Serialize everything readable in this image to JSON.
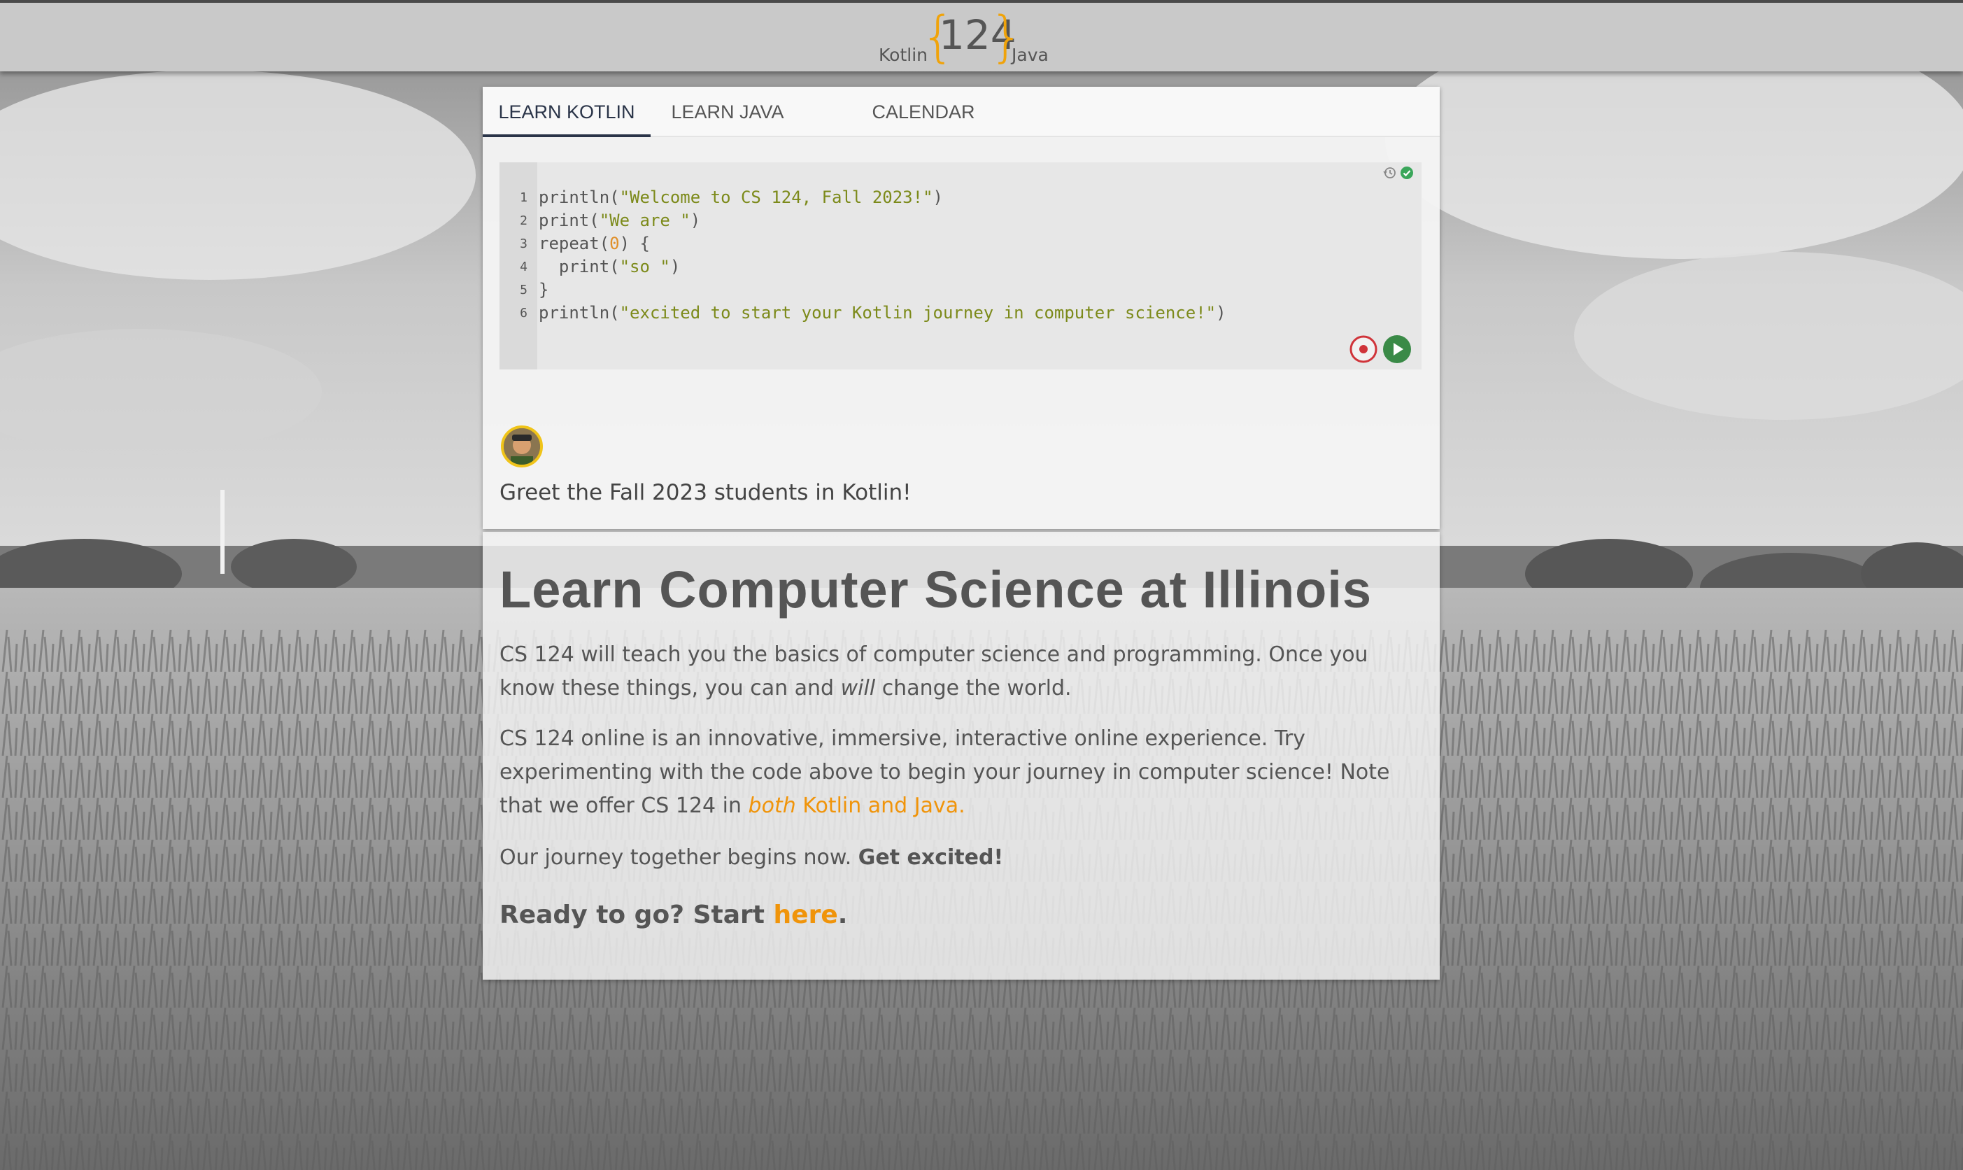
{
  "header": {
    "logo_left": "Kotlin",
    "logo_number": "124",
    "logo_right": "Java",
    "logo_brace_open": "{",
    "logo_brace_close": "}",
    "accent_color": "#f0a30a"
  },
  "tabs": [
    {
      "label": "LEARN KOTLIN",
      "active": true
    },
    {
      "label": "LEARN JAVA",
      "active": false
    },
    {
      "label": "CALENDAR",
      "active": false
    }
  ],
  "editor": {
    "line_numbers": [
      "1",
      "2",
      "3",
      "4",
      "5",
      "6"
    ],
    "lines": [
      {
        "pre": "println(",
        "str": "\"Welcome to CS 124, Fall 2023!\"",
        "post": ")"
      },
      {
        "pre": "print(",
        "str": "\"We are \"",
        "post": ")"
      },
      {
        "pre": "repeat(",
        "num": "0",
        "post": ") {"
      },
      {
        "pre": "  print(",
        "str": "\"so \"",
        "post": ")"
      },
      {
        "pre": "}"
      },
      {
        "pre": "println(",
        "str": "\"excited to start your Kotlin journey in computer science!\"",
        "post": ")"
      }
    ],
    "icons": [
      "history-icon",
      "check-circle-icon",
      "stop-record-icon",
      "play-icon"
    ],
    "string_color": "#7c8a1a",
    "number_color": "#e0902a"
  },
  "caption": "Greet the Fall 2023 students in Kotlin!",
  "content": {
    "headline": "Learn Computer Science at Illinois",
    "p1_a": "CS 124 will teach you the basics of computer science and programming. Once you know these things, you can and ",
    "p1_em": "will",
    "p1_b": " change the world.",
    "p2_a": "CS 124 online is an innovative, immersive, interactive online experience. Try experimenting with the code above to begin your journey in computer science! Note that we offer CS 124 in ",
    "p2_link_em": "both",
    "p2_link": " Kotlin and Java.",
    "p3_a": "Our journey together begins now. ",
    "p3_b": "Get excited!",
    "p4_a": "Ready to go? Start ",
    "p4_link": "here",
    "p4_b": ".",
    "link_color": "#f0940a"
  }
}
